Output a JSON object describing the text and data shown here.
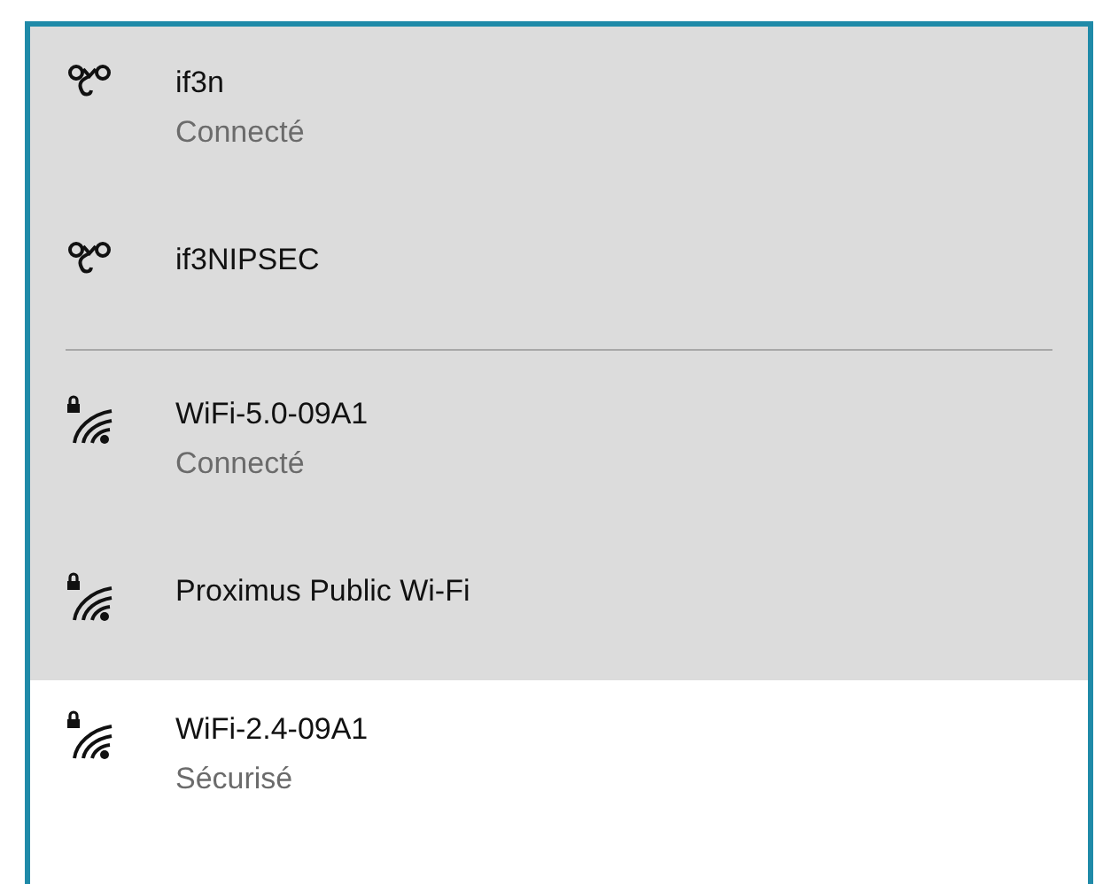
{
  "vpn_connections": [
    {
      "kind": "vpn",
      "name": "if3n",
      "status": "Connecté",
      "hovered": false
    },
    {
      "kind": "vpn",
      "name": "if3NIPSEC",
      "hovered": false
    }
  ],
  "wifi_networks": [
    {
      "kind": "wifi",
      "name": "WiFi-5.0-09A1",
      "status": "Connecté",
      "secured": true,
      "hovered": false
    },
    {
      "kind": "wifi",
      "name": "Proximus Public Wi-Fi",
      "secured": true,
      "hovered": false
    },
    {
      "kind": "wifi",
      "name": "WiFi-2.4-09A1",
      "status": "Sécurisé",
      "secured": true,
      "hovered": true
    }
  ]
}
